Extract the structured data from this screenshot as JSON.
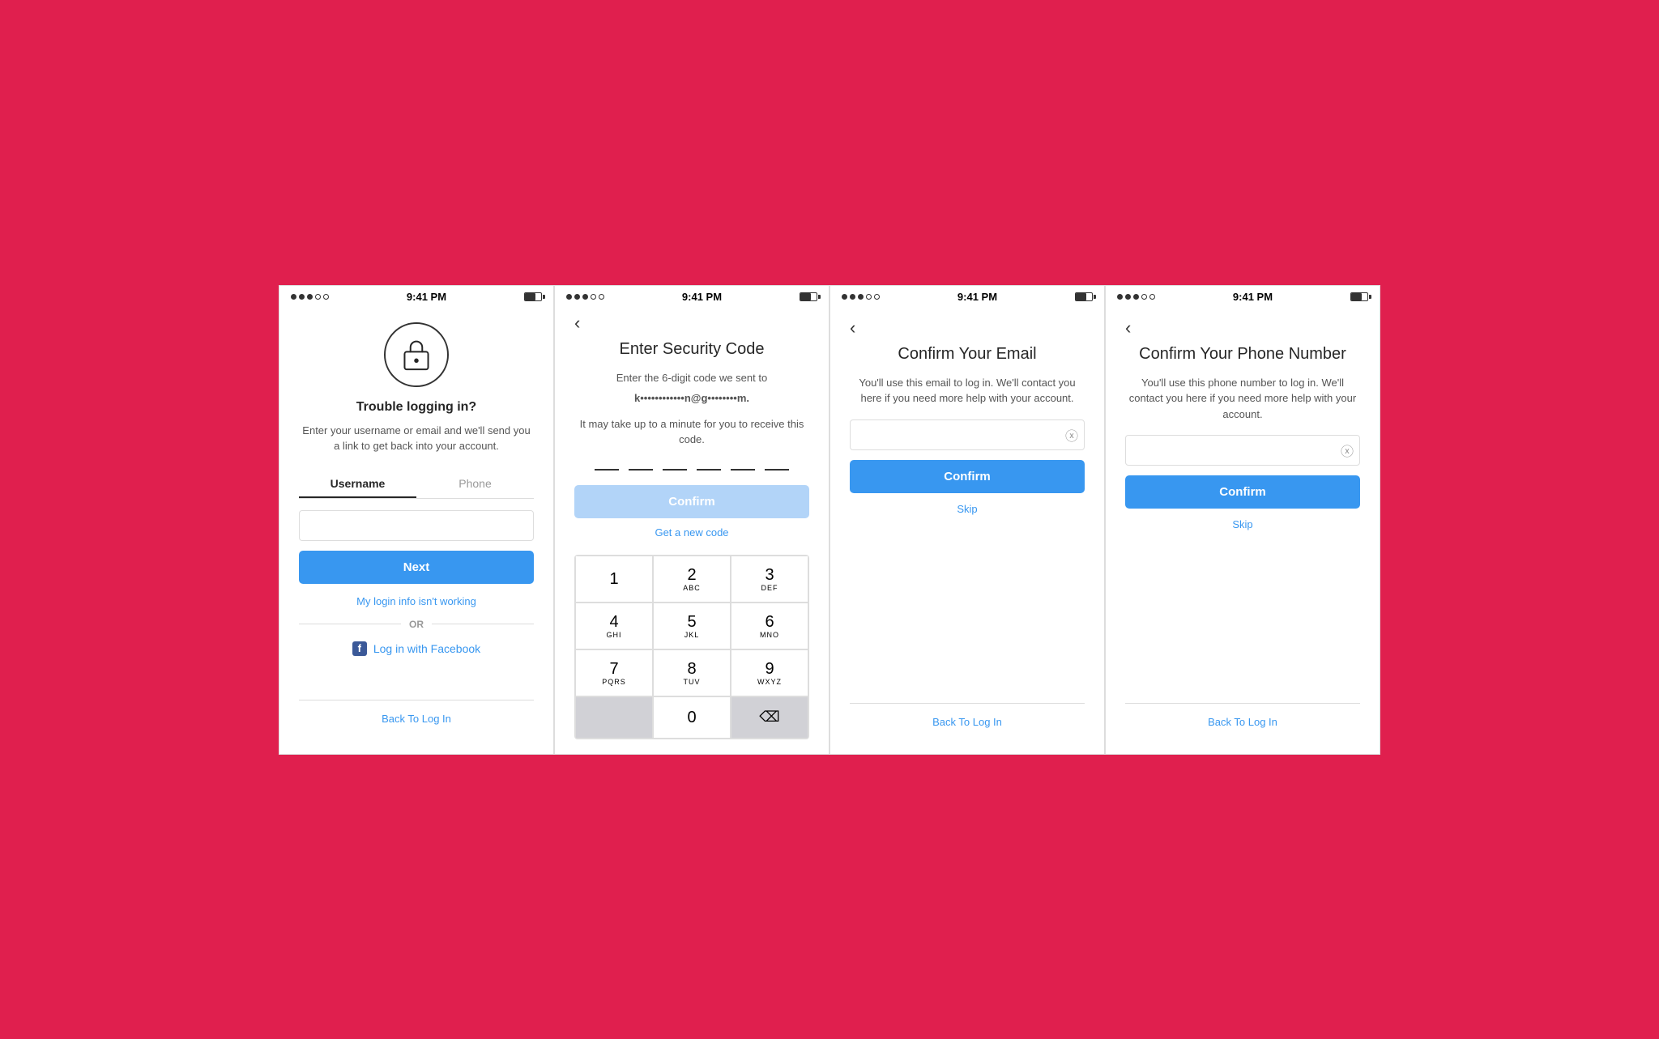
{
  "background_color": "#e01f4e",
  "screens": [
    {
      "id": "screen1",
      "status": {
        "time": "9:41 PM",
        "dots": [
          "filled",
          "filled",
          "filled",
          "empty",
          "empty"
        ]
      },
      "lock_icon": true,
      "title": "Trouble logging in?",
      "description": "Enter your username or email and we'll send you a link to get back into your account.",
      "tabs": [
        {
          "label": "Username",
          "active": true
        },
        {
          "label": "Phone",
          "active": false
        }
      ],
      "input_placeholder": "",
      "next_button": "Next",
      "trouble_link": "My login info isn't working",
      "or_text": "OR",
      "facebook_button": "Log in with Facebook",
      "back_link": "Back To Log In"
    },
    {
      "id": "screen2",
      "status": {
        "time": "9:41 PM"
      },
      "title": "Enter Security Code",
      "subtitle_line1": "Enter the 6-digit code we sent to",
      "masked_email": "k••••••••••••n@g••••••••m.",
      "subtitle_line2": "It may take up to a minute for you to receive this code.",
      "confirm_button": "Confirm",
      "get_new_code": "Get a new code",
      "numpad": [
        [
          {
            "num": "1",
            "alpha": ""
          },
          {
            "num": "2",
            "alpha": "ABC"
          },
          {
            "num": "3",
            "alpha": "DEF"
          }
        ],
        [
          {
            "num": "4",
            "alpha": "GHI"
          },
          {
            "num": "5",
            "alpha": "JKL"
          },
          {
            "num": "6",
            "alpha": "MNO"
          }
        ],
        [
          {
            "num": "7",
            "alpha": "PQRS"
          },
          {
            "num": "8",
            "alpha": "TUV"
          },
          {
            "num": "9",
            "alpha": "WXYZ"
          }
        ],
        [
          {
            "num": "",
            "alpha": "",
            "type": "empty"
          },
          {
            "num": "0",
            "alpha": ""
          },
          {
            "num": "⌫",
            "alpha": "",
            "type": "delete"
          }
        ]
      ]
    },
    {
      "id": "screen3",
      "status": {
        "time": "9:41 PM"
      },
      "title": "Confirm Your Email",
      "description": "You'll use this email to log in. We'll contact you here if you need more help with your account.",
      "input_value": "",
      "confirm_button": "Confirm",
      "skip_link": "Skip",
      "back_link": "Back To Log In"
    },
    {
      "id": "screen4",
      "status": {
        "time": "9:41 PM"
      },
      "title": "Confirm Your Phone Number",
      "description": "You'll use this phone number to log in. We'll contact you here if you need more help with your account.",
      "input_value": "",
      "confirm_button": "Confirm",
      "skip_link": "Skip",
      "back_link": "Back To Log In"
    }
  ]
}
